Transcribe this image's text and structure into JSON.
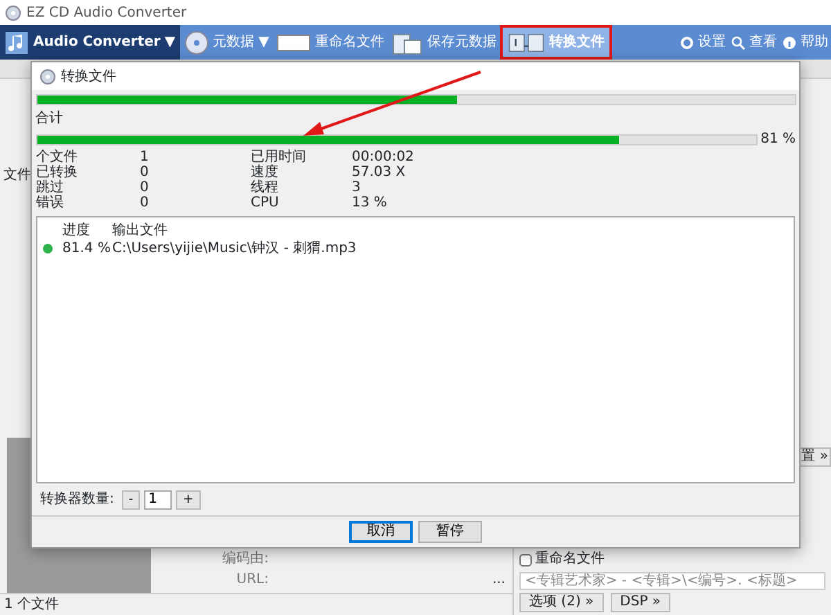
{
  "window": {
    "title": "EZ CD Audio Converter"
  },
  "toolbar": {
    "items": [
      {
        "label": "Audio Converter",
        "caret": "▼",
        "kind": "mode",
        "highlighted": false
      },
      {
        "label": "元数据",
        "caret": "▼",
        "kind": "disc",
        "highlighted": false
      },
      {
        "label": "重命名文件",
        "kind": "rename",
        "highlighted": false
      },
      {
        "label": "保存元数据",
        "kind": "save",
        "highlighted": false
      },
      {
        "label": "转换文件",
        "kind": "convert",
        "highlighted": true
      }
    ],
    "right": [
      {
        "label": "设置",
        "kind": "settings"
      },
      {
        "label": "查看",
        "kind": "search"
      },
      {
        "label": "帮助",
        "kind": "help"
      }
    ]
  },
  "side_label": "文件",
  "side_button": "置 »",
  "metadata": [
    {
      "label": "编码由:"
    },
    {
      "label": "URL:",
      "value": "..."
    }
  ],
  "rename": {
    "label": "重命名文件",
    "checked": false,
    "template": "<专辑艺术家> - <专辑>\\<编号>. <标题>"
  },
  "bottom_buttons": [
    "选项 (2) »",
    "DSP »"
  ],
  "status_bar": "1 个文件",
  "dialog": {
    "title": "转换文件",
    "file_progress": {
      "level": 0.555
    },
    "total_label": "合计",
    "total_progress": {
      "level": 0.81,
      "reading": "81 %"
    },
    "stats": [
      {
        "label": "个文件",
        "value": "1",
        "label2": "已用时间",
        "value2": "00:00:02"
      },
      {
        "label": "已转换",
        "value": "0",
        "label2": "速度",
        "value2": "57.03 X"
      },
      {
        "label": "跳过",
        "value": "0",
        "label2": "线程",
        "value2": "3"
      },
      {
        "label": "错误",
        "value": "0",
        "label2": "CPU",
        "value2": "13 %"
      }
    ],
    "columns": [
      "进度",
      "输出文件"
    ],
    "rows": [
      {
        "color": "#2db34a",
        "progress": "81.4 %",
        "file": "C:\\Users\\yijie\\Music\\钟汉 - 刺猬.mp3"
      }
    ],
    "converter_count": {
      "label": "转换器数量:",
      "minus": "-",
      "value": "1",
      "plus": "+"
    },
    "buttons": [
      {
        "label": "取消",
        "default": true
      },
      {
        "label": "暂停",
        "default": false
      }
    ]
  }
}
